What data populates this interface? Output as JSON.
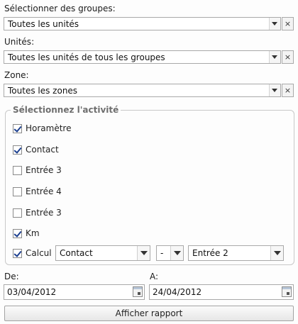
{
  "groups": {
    "label": "Sélectionner des groupes:",
    "value": "Toutes les unités"
  },
  "units": {
    "label": "Unités:",
    "value": "Toutes les unités de tous les groupes"
  },
  "zone": {
    "label": "Zone:",
    "value": "Toutes les zones"
  },
  "clear_symbol": "×",
  "activity": {
    "legend": "Sélectionnez l'activité",
    "items": [
      {
        "label": "Horamètre",
        "checked": true
      },
      {
        "label": "Contact",
        "checked": true
      },
      {
        "label": "Entrée 3",
        "checked": false
      },
      {
        "label": "Entrée 4",
        "checked": false
      },
      {
        "label": "Entrée 3",
        "checked": false
      },
      {
        "label": "Km",
        "checked": true
      },
      {
        "label": "Calcul",
        "checked": true
      }
    ],
    "calc": {
      "operand1": "Contact",
      "operator": "-",
      "operand2": "Entrée 2"
    }
  },
  "date_from": {
    "label": "De:",
    "value": "03/04/2012"
  },
  "date_to": {
    "label": "A:",
    "value": "24/04/2012"
  },
  "submit_label": "Afficher rapport"
}
